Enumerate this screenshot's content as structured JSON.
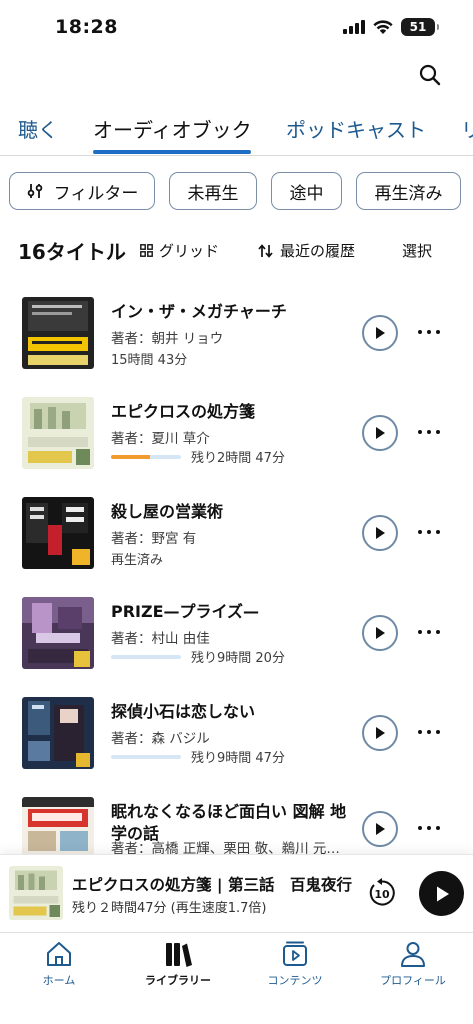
{
  "status_bar": {
    "time": "18:28",
    "battery": "51"
  },
  "tabs": [
    {
      "label": "聴く"
    },
    {
      "label": "オーディオブック"
    },
    {
      "label": "ポッドキャスト"
    },
    {
      "label": "リ"
    }
  ],
  "filters": {
    "filter_label": "フィルター",
    "chips": [
      "未再生",
      "途中",
      "再生済み"
    ]
  },
  "toolbar": {
    "count": "16タイトル",
    "grid_label": "グリッド",
    "sort_label": "最近の履歴",
    "select_label": "選択"
  },
  "books": [
    {
      "title": "イン・ザ・メガチャーチ",
      "author": "著者：朝井 リョウ",
      "meta": "15時間 43分"
    },
    {
      "title": "エピクロスの処方箋",
      "author": "著者：夏川 草介",
      "progress": 0.55,
      "remaining": "残り2時間 47分"
    },
    {
      "title": "殺し屋の営業術",
      "author": "著者：野宮 有",
      "meta": "再生済み"
    },
    {
      "title": "PRIZE—プライズ—",
      "author": "著者：村山 由佳",
      "progress": 0,
      "remaining": "残り9時間 20分"
    },
    {
      "title": "探偵小石は恋しない",
      "author": "著者：森 バジル",
      "progress": 0,
      "remaining": "残り9時間 47分"
    },
    {
      "title": "眠れなくなるほど面白い 図解 地学の話",
      "author": "著者：高橋 正輝、栗田 敬、鵜川 元…"
    }
  ],
  "now_playing": {
    "title": "エピクロスの処方箋 | 第三話　百鬼夜行",
    "subtitle": "残り２時間47分 (再生速度1.7倍)",
    "skip_seconds": "10"
  },
  "nav": [
    {
      "label": "ホーム"
    },
    {
      "label": "ライブラリー"
    },
    {
      "label": "コンテンツ"
    },
    {
      "label": "プロフィール"
    }
  ],
  "colors": {
    "accent": "#1e6fc4",
    "link": "#1e5a8e",
    "progress": "#f39a2c"
  }
}
